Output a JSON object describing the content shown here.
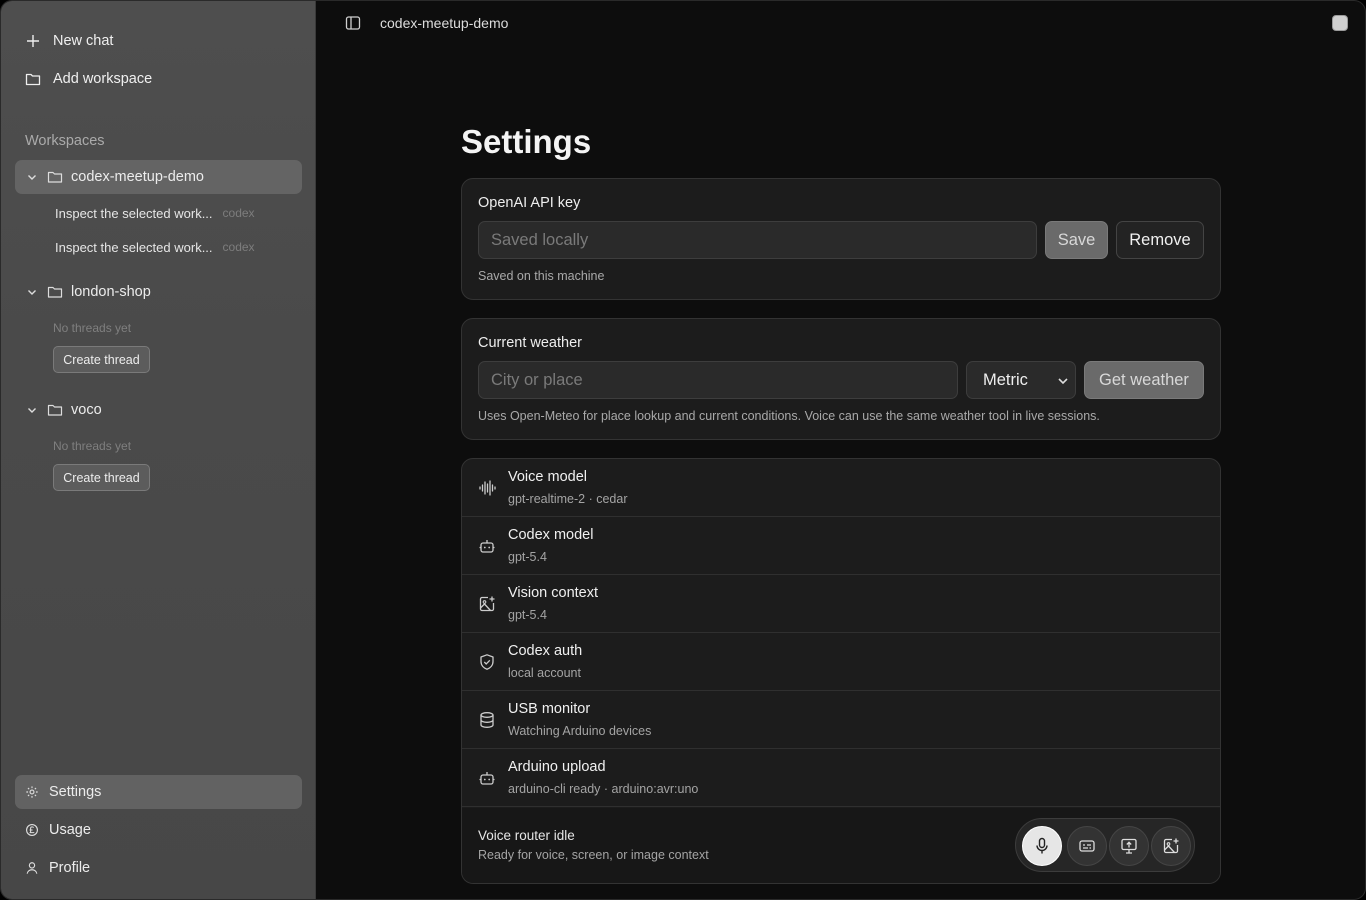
{
  "topbar": {
    "title": "codex-meetup-demo"
  },
  "sidebar": {
    "new_chat": "New chat",
    "add_workspace": "Add workspace",
    "workspaces_label": "Workspaces",
    "workspaces": [
      {
        "name": "codex-meetup-demo",
        "threads": [
          {
            "title": "Inspect the selected work...",
            "tag": "codex"
          },
          {
            "title": "Inspect the selected work...",
            "tag": "codex"
          }
        ]
      },
      {
        "name": "london-shop",
        "empty_note": "No threads yet",
        "create_label": "Create thread"
      },
      {
        "name": "voco",
        "empty_note": "No threads yet",
        "create_label": "Create thread"
      }
    ],
    "bottom": {
      "settings": "Settings",
      "usage": "Usage",
      "profile": "Profile"
    }
  },
  "settings": {
    "title": "Settings",
    "api_key": {
      "label": "OpenAI API key",
      "placeholder": "Saved locally",
      "save": "Save",
      "remove": "Remove",
      "note": "Saved on this machine"
    },
    "weather": {
      "label": "Current weather",
      "placeholder": "City or place",
      "unit": "Metric",
      "button": "Get weather",
      "note": "Uses Open-Meteo for place lookup and current conditions. Voice can use the same weather tool in live sessions."
    },
    "rows": [
      {
        "title": "Voice model",
        "sub": "gpt-realtime-2 · cedar",
        "icon": "waveform-icon"
      },
      {
        "title": "Codex model",
        "sub": "gpt-5.4",
        "icon": "robot-icon"
      },
      {
        "title": "Vision context",
        "sub": "gpt-5.4",
        "icon": "image-plus-icon"
      },
      {
        "title": "Codex auth",
        "sub": "local account",
        "icon": "shield-check-icon"
      },
      {
        "title": "USB monitor",
        "sub": "Watching Arduino devices",
        "icon": "database-icon"
      },
      {
        "title": "Arduino upload",
        "sub": "arduino-cli ready · arduino:avr:uno",
        "icon": "robot-icon"
      }
    ],
    "router": {
      "title": "Voice router idle",
      "sub": "Ready for voice, screen, or image context"
    }
  }
}
